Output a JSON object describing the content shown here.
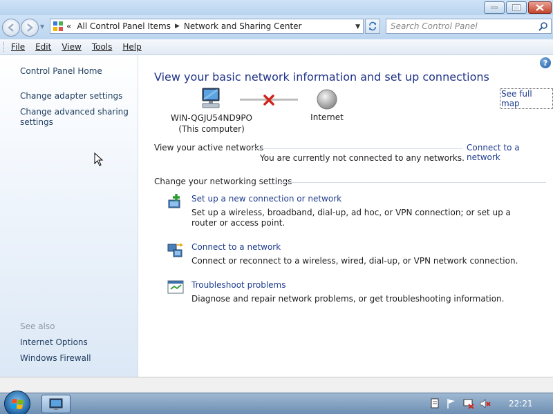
{
  "titlebar": {
    "min_icon": "minimize-icon",
    "max_icon": "maximize-icon",
    "close_icon": "close-icon"
  },
  "address": {
    "overflow": "«",
    "crumb1": "All Control Panel Items",
    "crumb2": "Network and Sharing Center",
    "search_placeholder": "Search Control Panel"
  },
  "menu": {
    "file": "File",
    "edit": "Edit",
    "view": "View",
    "tools": "Tools",
    "help": "Help"
  },
  "left_pane": {
    "home": "Control Panel Home",
    "adapter": "Change adapter settings",
    "advanced": "Change advanced sharing settings",
    "see_also": "See also",
    "internet_options": "Internet Options",
    "windows_firewall": "Windows Firewall"
  },
  "main": {
    "title": "View your basic network information and set up connections",
    "see_full_map": "See full map",
    "computer_name": "WIN-QGJU54ND9PO",
    "computer_sub": "(This computer)",
    "internet": "Internet",
    "active_networks_header": "View your active networks",
    "connect_link": "Connect to a network",
    "not_connected": "You are currently not connected to any networks.",
    "change_header": "Change your networking settings",
    "tasks": [
      {
        "link": "Set up a new connection or network",
        "desc": "Set up a wireless, broadband, dial-up, ad hoc, or VPN connection; or set up a router or access point."
      },
      {
        "link": "Connect to a network",
        "desc": "Connect or reconnect to a wireless, wired, dial-up, or VPN network connection."
      },
      {
        "link": "Troubleshoot problems",
        "desc": "Diagnose and repair network problems, or get troubleshooting information."
      }
    ]
  },
  "taskbar": {
    "clock": "22:21"
  }
}
